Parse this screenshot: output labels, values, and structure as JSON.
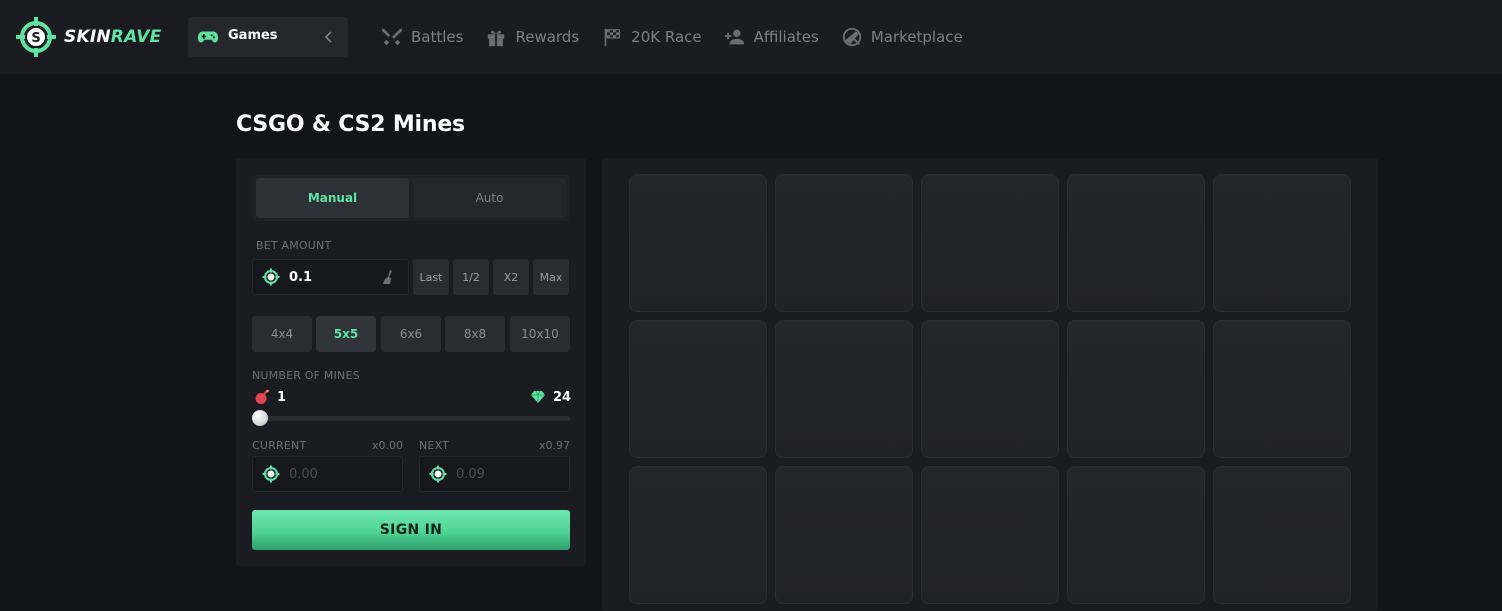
{
  "header": {
    "logo": {
      "text_main": "SKIN",
      "text_accent": "RAVE",
      "icon": "skinrave-crosshair-logo"
    },
    "games_button": {
      "label": "Games",
      "icon": "gamepad-icon",
      "chevron": "chevron-left-icon"
    },
    "nav": [
      {
        "label": "Battles",
        "icon": "crossed-swords-icon"
      },
      {
        "label": "Rewards",
        "icon": "gift-icon"
      },
      {
        "label": "20K Race",
        "icon": "checkered-flag-icon"
      },
      {
        "label": "Affiliates",
        "icon": "user-plus-icon"
      },
      {
        "label": "Marketplace",
        "icon": "marketplace-icon"
      }
    ]
  },
  "page_title": "CSGO & CS2 Mines",
  "panel": {
    "modes": {
      "manual": "Manual",
      "auto": "Auto",
      "active": "manual"
    },
    "bet_amount_label": "BET AMOUNT",
    "bet_value": "0.1",
    "quick": [
      "Last",
      "1/2",
      "X2",
      "Max"
    ],
    "grid_sizes": [
      "4x4",
      "5x5",
      "6x6",
      "8x8",
      "10x10"
    ],
    "active_grid_size": "5x5",
    "mines_label": "NUMBER OF MINES",
    "mines_count": "1",
    "gems_count": "24",
    "slider_fraction": 0,
    "current_label": "CURRENT",
    "current_multiplier": "x0.00",
    "current_value": "0.00",
    "next_label": "NEXT",
    "next_multiplier": "x0.97",
    "next_value": "0.09",
    "signin_label": "SIGN IN"
  },
  "colors": {
    "accent": "#5fe3a1",
    "background": "#131419",
    "panel": "#1b1c22",
    "mine_red": "#e0484c",
    "gem_green": "#5fe3a1"
  },
  "board": {
    "columns": 5,
    "visible_rows": 3,
    "tile_state": "hidden"
  }
}
